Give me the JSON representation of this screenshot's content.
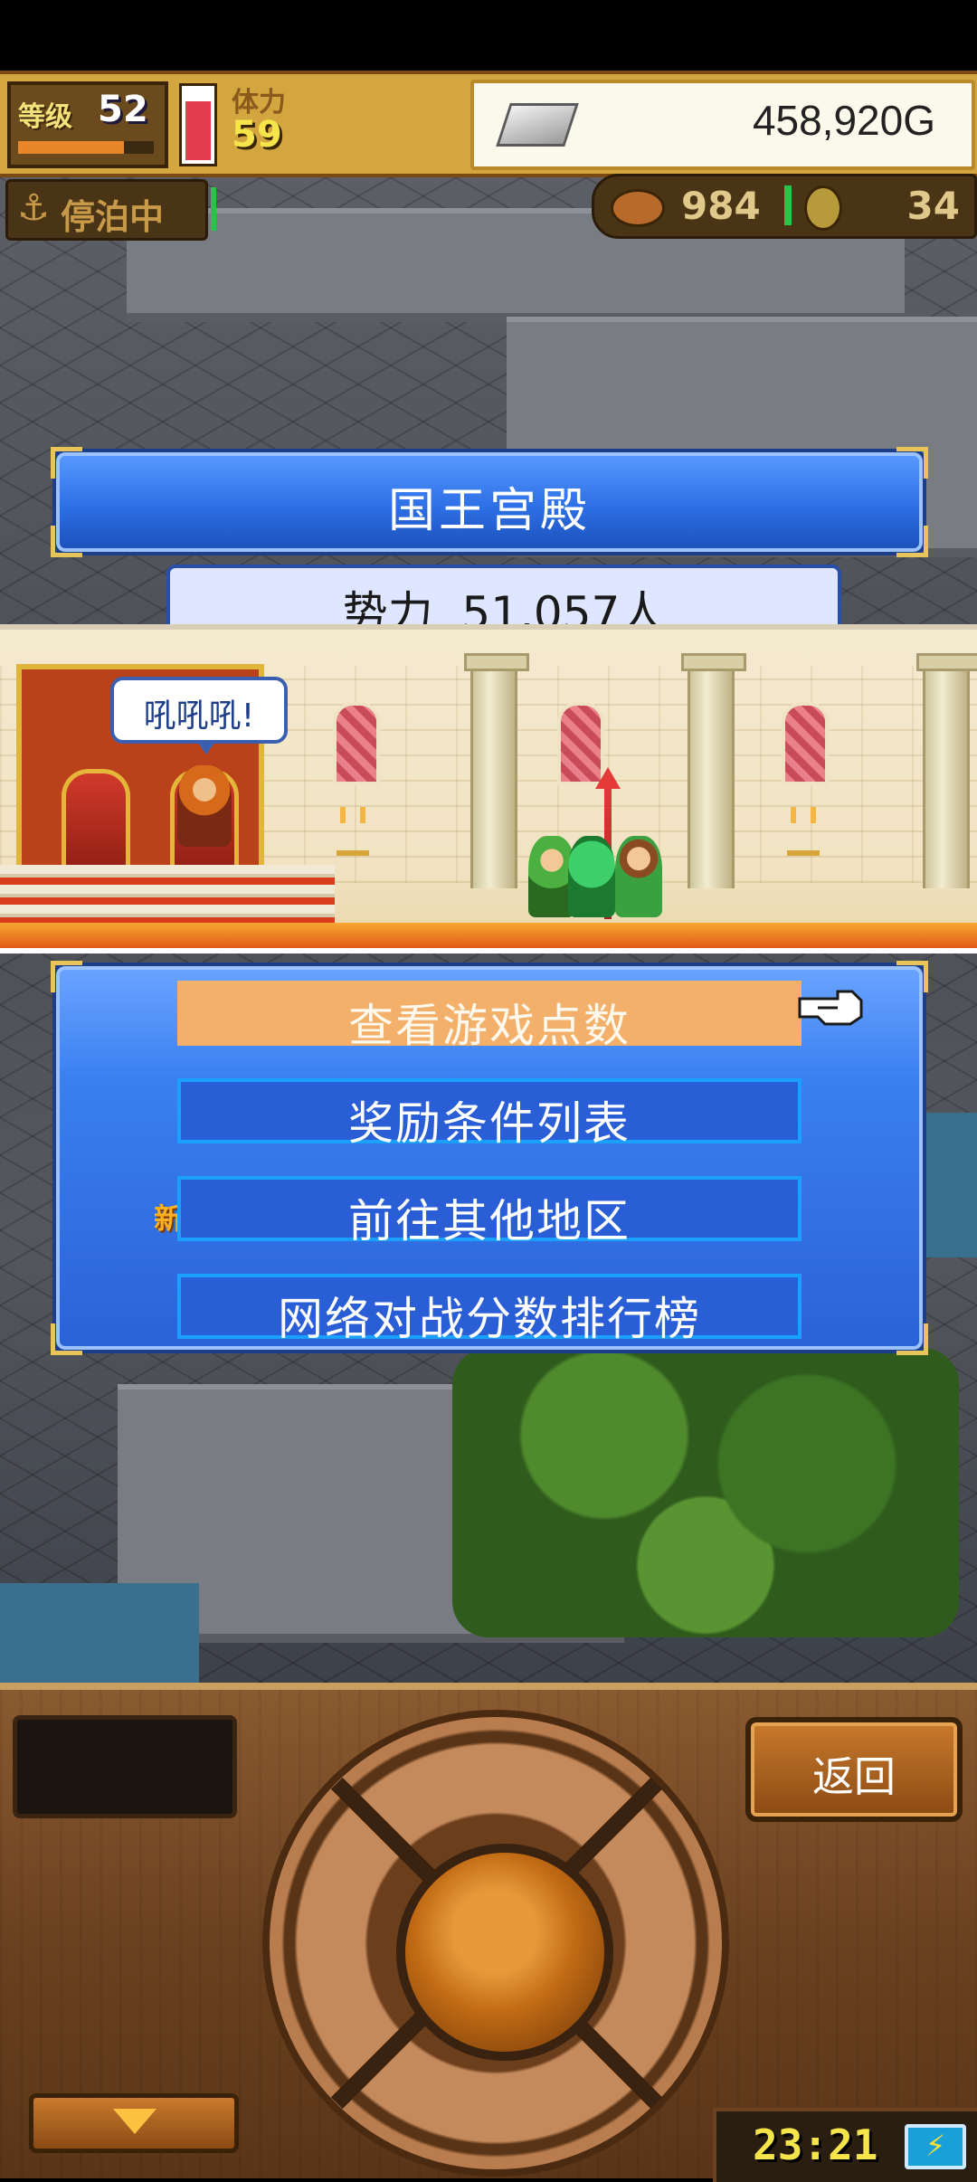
{
  "status": {
    "level_label": "等级",
    "level": "52",
    "exp_fraction": 0.78,
    "hp_fraction": 0.85,
    "stamina_label": "体力",
    "stamina": "59",
    "gold": "458,920G",
    "gold_icon": "silver-bar-icon"
  },
  "port": {
    "docked_label": "停泊中",
    "anchor_icon": "anchor-icon"
  },
  "resources": {
    "food": "984",
    "medal": "34",
    "food_icon": "meat-icon",
    "medal_icon": "medal-icon"
  },
  "location": {
    "title": "国王宫殿",
    "power": "势力  51,057人"
  },
  "scene": {
    "king_speech": "吼吼吼!"
  },
  "menu": {
    "items": [
      {
        "label": "查看游戏点数",
        "selected": true
      },
      {
        "label": "奖励条件列表",
        "selected": false
      },
      {
        "label": "前往其他地区",
        "selected": false,
        "badge": "新"
      },
      {
        "label": "网络对战分数排行榜",
        "selected": false
      }
    ],
    "pointer_icon": "pointing-hand-icon"
  },
  "controls": {
    "back_label": "返回",
    "clock": "23:21",
    "battery_icon": "charging-battery-icon"
  },
  "colors": {
    "panel_blue": "#2d6fe6",
    "menu_selected": "#f2b06a",
    "gold_border": "#e8c55a"
  }
}
